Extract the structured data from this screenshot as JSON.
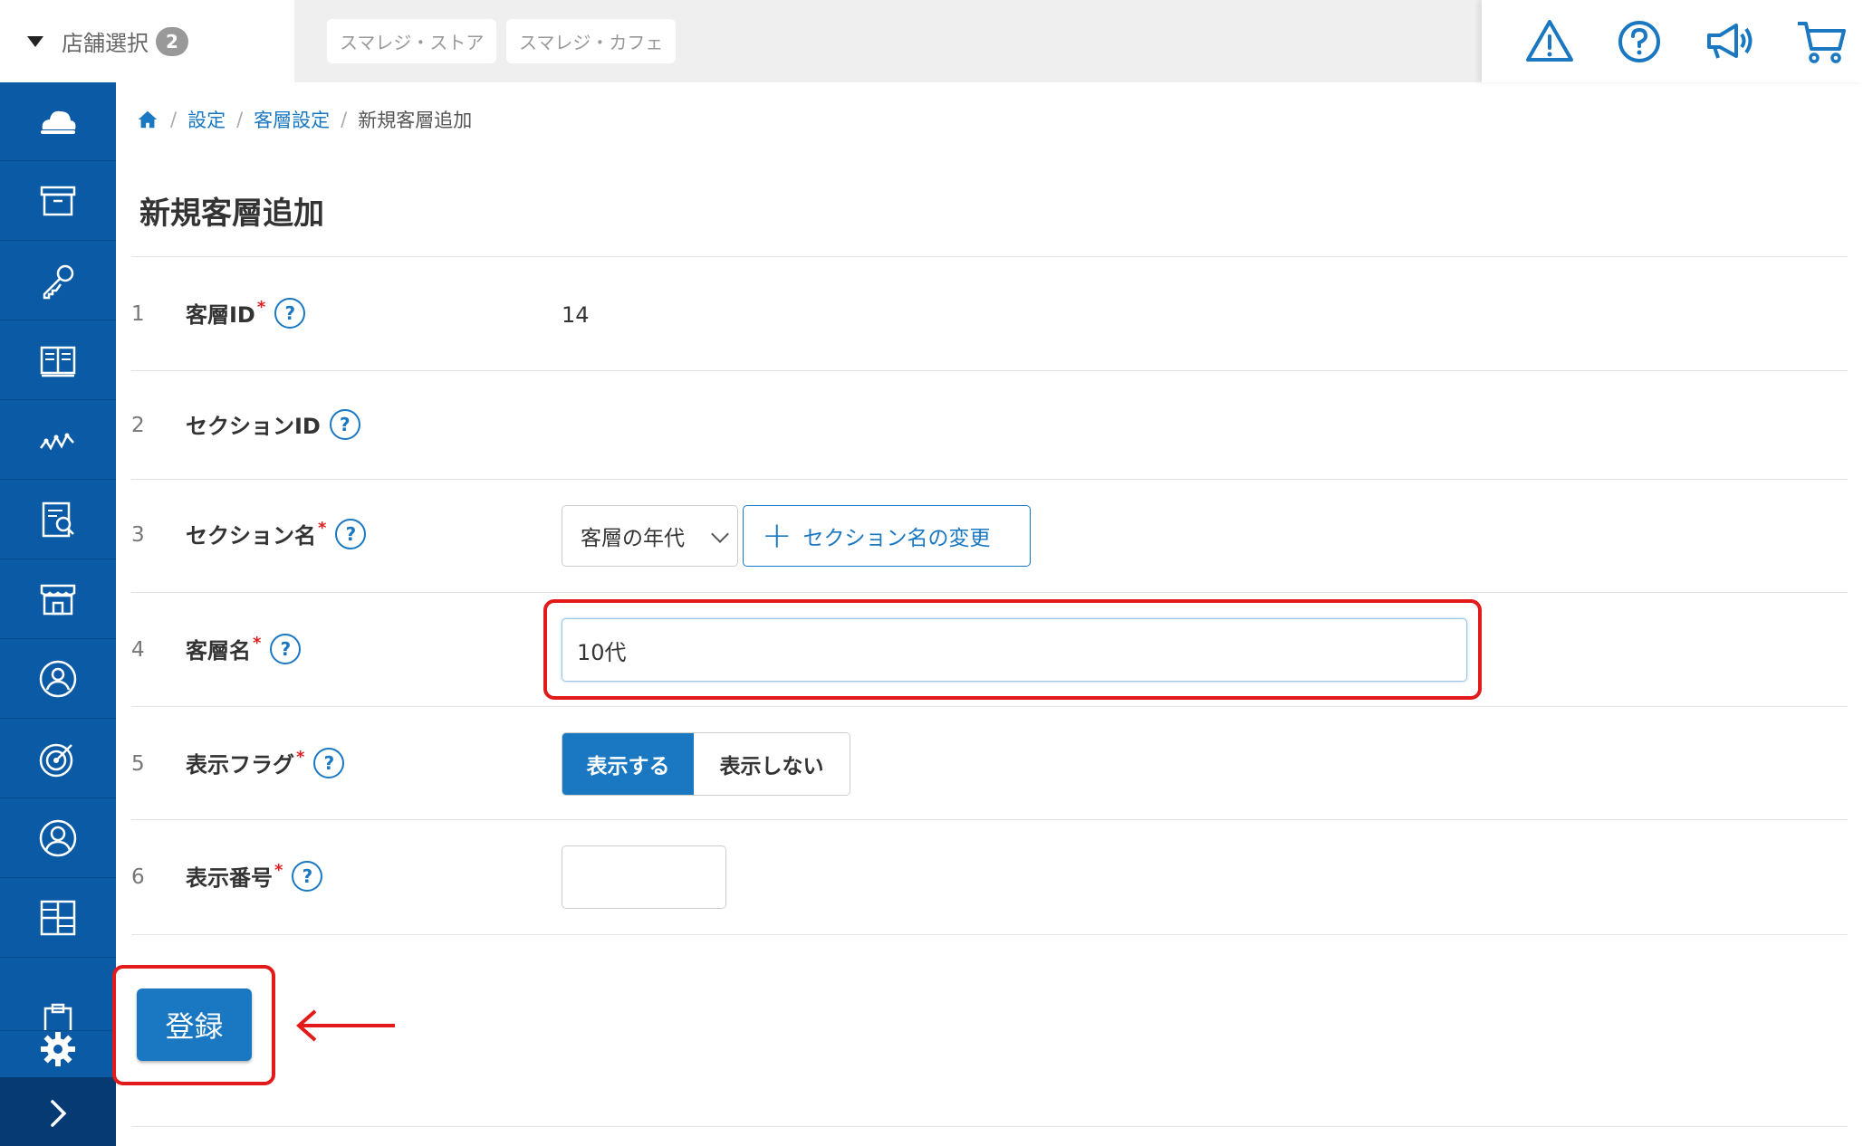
{
  "topbar": {
    "store_select_label": "店舗選択",
    "store_count": "2",
    "store_tabs": [
      "スマレジ・ストア",
      "スマレジ・カフェ"
    ],
    "icons": [
      "warning-icon",
      "help-icon",
      "megaphone-icon",
      "cart-icon"
    ]
  },
  "sidebar": {
    "icons": [
      "cloud-icon",
      "archive-box-icon",
      "key-icon",
      "book-icon",
      "chart-line-icon",
      "report-search-icon",
      "store-icon",
      "customer-icon",
      "target-icon",
      "user-icon",
      "grid-icon",
      "clipboard-icon",
      "gear-icon",
      "chevron-right-icon"
    ]
  },
  "breadcrumb": {
    "home_icon": "home-icon",
    "items": [
      "設定",
      "客層設定"
    ],
    "current": "新規客層追加"
  },
  "page_title": "新規客層追加",
  "form": {
    "rows": [
      {
        "num": "1",
        "label": "客層ID",
        "required": "*",
        "help": "?",
        "value": "14"
      },
      {
        "num": "2",
        "label": "セクションID",
        "help": "?"
      },
      {
        "num": "3",
        "label": "セクション名",
        "required": "*",
        "help": "?",
        "select_value": "客層の年代",
        "button_label": "セクション名の変更"
      },
      {
        "num": "4",
        "label": "客層名",
        "required": "*",
        "help": "?",
        "input_value": "10代"
      },
      {
        "num": "5",
        "label": "表示フラグ",
        "required": "*",
        "help": "?",
        "toggle_on": "表示する",
        "toggle_off": "表示しない"
      },
      {
        "num": "6",
        "label": "表示番号",
        "required": "*",
        "help": "?",
        "input_value": ""
      }
    ]
  },
  "submit_label": "登録",
  "colors": {
    "primary": "#1a78c2",
    "sidebar": "#0b5aa6",
    "highlight": "#e31a1a"
  }
}
